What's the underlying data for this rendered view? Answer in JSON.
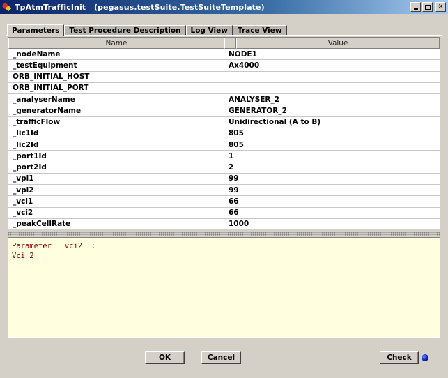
{
  "window": {
    "title": "TpAtmTrafficInit   (pegasus.testSuite.TestSuiteTemplate)",
    "minimize_label": "_",
    "close_label": "✕"
  },
  "tabs": [
    {
      "label": "Parameters",
      "active": true
    },
    {
      "label": "Test Procedure Description",
      "active": false
    },
    {
      "label": "Log View",
      "active": false
    },
    {
      "label": "Trace View",
      "active": false
    }
  ],
  "table": {
    "columns": [
      "Name",
      "Value"
    ],
    "rows": [
      {
        "name": "_nodeName",
        "value": "NODE1"
      },
      {
        "name": "_testEquipment",
        "value": "Ax4000"
      },
      {
        "name": "ORB_INITIAL_HOST",
        "value": ""
      },
      {
        "name": "ORB_INITIAL_PORT",
        "value": ""
      },
      {
        "name": "_analyserName",
        "value": "ANALYSER_2"
      },
      {
        "name": "_generatorName",
        "value": "GENERATOR_2"
      },
      {
        "name": "_trafficFlow",
        "value": "Unidirectional (A to B)"
      },
      {
        "name": "_lic1Id",
        "value": "805"
      },
      {
        "name": "_lic2Id",
        "value": "805"
      },
      {
        "name": "_port1Id",
        "value": "1"
      },
      {
        "name": "_port2Id",
        "value": "2"
      },
      {
        "name": "_vpi1",
        "value": "99"
      },
      {
        "name": "_vpi2",
        "value": "99"
      },
      {
        "name": "_vci1",
        "value": "66"
      },
      {
        "name": "_vci2",
        "value": "66"
      },
      {
        "name": "_peakCellRate",
        "value": "1000"
      }
    ]
  },
  "description": {
    "lines": [
      "Parameter  _vci2  :",
      "Vci 2"
    ]
  },
  "buttons": {
    "ok": "OK",
    "cancel": "Cancel",
    "check": "Check"
  },
  "colors": {
    "titlebar": "#0a246a",
    "description_bg": "#ffffe0",
    "description_text": "#8b0000",
    "status_dot": "#0018b8"
  }
}
